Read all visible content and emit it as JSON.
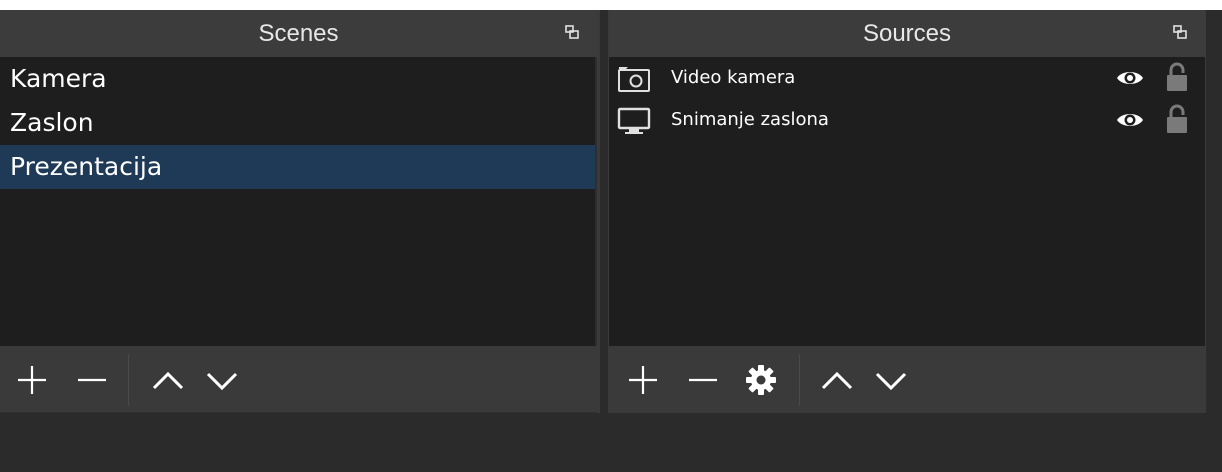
{
  "scenes": {
    "title": "Scenes",
    "items": [
      {
        "label": "Kamera",
        "selected": false
      },
      {
        "label": "Zaslon",
        "selected": false
      },
      {
        "label": "Prezentacija",
        "selected": true
      }
    ],
    "toolbar": [
      "plus-icon",
      "minus-icon",
      "chevron-up-icon",
      "chevron-down-icon"
    ]
  },
  "sources": {
    "title": "Sources",
    "items": [
      {
        "label": "Video kamera",
        "icon": "camera-icon",
        "visible": true,
        "locked": false
      },
      {
        "label": "Snimanje zaslona",
        "icon": "monitor-icon",
        "visible": true,
        "locked": false
      }
    ],
    "toolbar": [
      "plus-icon",
      "minus-icon",
      "gear-icon",
      "chevron-up-icon",
      "chevron-down-icon"
    ]
  },
  "colors": {
    "selection": "#1e3a57",
    "list_bg": "#1e1e1e",
    "header_bg": "#3c3c3c",
    "toolbar_bg": "#3a3a3a"
  }
}
